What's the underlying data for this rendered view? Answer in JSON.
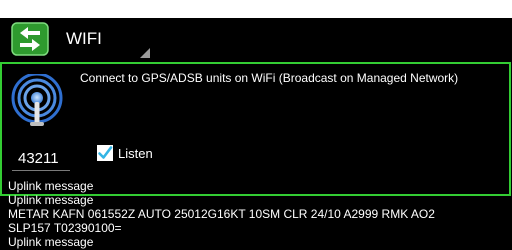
{
  "app": {
    "title": "WIFI",
    "icon": "green-bidirectional-arrows-icon"
  },
  "panel": {
    "icon": "wifi-broadcast-icon",
    "description": "Connect to GPS/ADSB units on WiFi (Broadcast on Managed Network)",
    "port_value": "43211",
    "listen_label": "Listen",
    "listen_checked": true
  },
  "log": {
    "lines": [
      "Uplink message",
      "Uplink message",
      "METAR KAFN 061552Z AUTO 25012G16KT 10SM CLR 24/10 A2999 RMK AO2",
      "SLP157 T02390100=",
      "Uplink message"
    ]
  },
  "colors": {
    "accent_green": "#33cc33",
    "checkbox_blue": "#33b5e5",
    "background": "#000000"
  }
}
